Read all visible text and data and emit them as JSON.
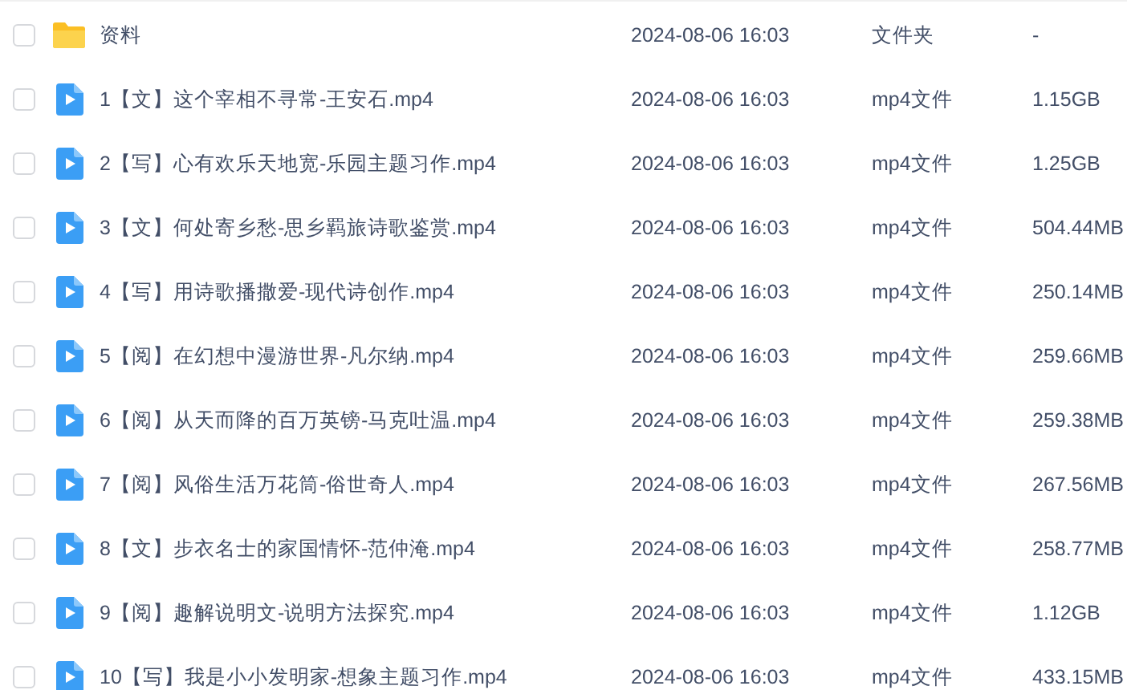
{
  "files": [
    {
      "kind": "folder",
      "checked": false,
      "name": "资料",
      "modified": "2024-08-06 16:03",
      "type": "文件夹",
      "size": "-"
    },
    {
      "kind": "video",
      "checked": false,
      "name": "1【文】这个宰相不寻常-王安石.mp4",
      "modified": "2024-08-06 16:03",
      "type": "mp4文件",
      "size": "1.15GB"
    },
    {
      "kind": "video",
      "checked": false,
      "name": "2【写】心有欢乐天地宽-乐园主题习作.mp4",
      "modified": "2024-08-06 16:03",
      "type": "mp4文件",
      "size": "1.25GB"
    },
    {
      "kind": "video",
      "checked": false,
      "name": "3【文】何处寄乡愁-思乡羁旅诗歌鉴赏.mp4",
      "modified": "2024-08-06 16:03",
      "type": "mp4文件",
      "size": "504.44MB"
    },
    {
      "kind": "video",
      "checked": false,
      "name": "4【写】用诗歌播撒爱-现代诗创作.mp4",
      "modified": "2024-08-06 16:03",
      "type": "mp4文件",
      "size": "250.14MB"
    },
    {
      "kind": "video",
      "checked": false,
      "name": "5【阅】在幻想中漫游世界-凡尔纳.mp4",
      "modified": "2024-08-06 16:03",
      "type": "mp4文件",
      "size": "259.66MB"
    },
    {
      "kind": "video",
      "checked": false,
      "name": "6【阅】从天而降的百万英镑-马克吐温.mp4",
      "modified": "2024-08-06 16:03",
      "type": "mp4文件",
      "size": "259.38MB"
    },
    {
      "kind": "video",
      "checked": false,
      "name": "7【阅】风俗生活万花筒-俗世奇人.mp4",
      "modified": "2024-08-06 16:03",
      "type": "mp4文件",
      "size": "267.56MB"
    },
    {
      "kind": "video",
      "checked": false,
      "name": "8【文】步衣名士的家国情怀-范仲淹.mp4",
      "modified": "2024-08-06 16:03",
      "type": "mp4文件",
      "size": "258.77MB"
    },
    {
      "kind": "video",
      "checked": false,
      "name": "9【阅】趣解说明文-说明方法探究.mp4",
      "modified": "2024-08-06 16:03",
      "type": "mp4文件",
      "size": "1.12GB"
    },
    {
      "kind": "video",
      "checked": false,
      "name": "10【写】我是小小发明家-想象主题习作.mp4",
      "modified": "2024-08-06 16:03",
      "type": "mp4文件",
      "size": "433.15MB"
    }
  ]
}
